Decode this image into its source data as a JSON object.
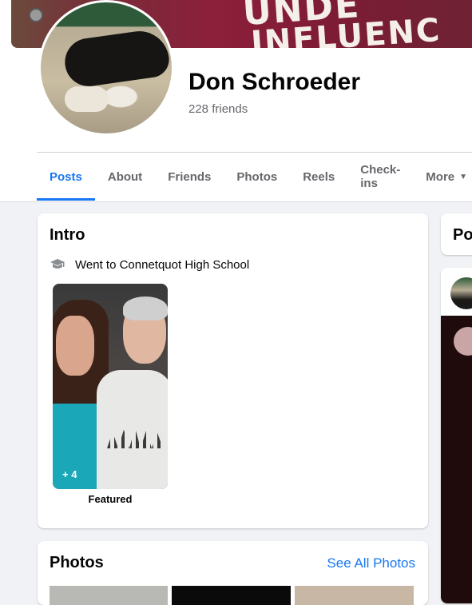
{
  "profile": {
    "name": "Don Schroeder",
    "friends": "228 friends",
    "cover_text_line1": "UNDE",
    "cover_text_line2": "INFLUENC"
  },
  "tabs": [
    {
      "label": "Posts",
      "active": true
    },
    {
      "label": "About"
    },
    {
      "label": "Friends"
    },
    {
      "label": "Photos"
    },
    {
      "label": "Reels"
    },
    {
      "label": "Check-ins"
    },
    {
      "label": "More"
    }
  ],
  "intro": {
    "title": "Intro",
    "education": "Went to Connetquot High School",
    "featured_count": "+ 4",
    "featured_label": "Featured"
  },
  "photos": {
    "title": "Photos",
    "see_all": "See All Photos"
  },
  "right_column": {
    "title": "Po"
  },
  "colors": {
    "accent": "#1877f2",
    "background": "#f0f2f5",
    "secondary_text": "#65676b"
  },
  "icons": {
    "school": "graduation-cap-icon",
    "more_caret": "caret-down-icon"
  }
}
